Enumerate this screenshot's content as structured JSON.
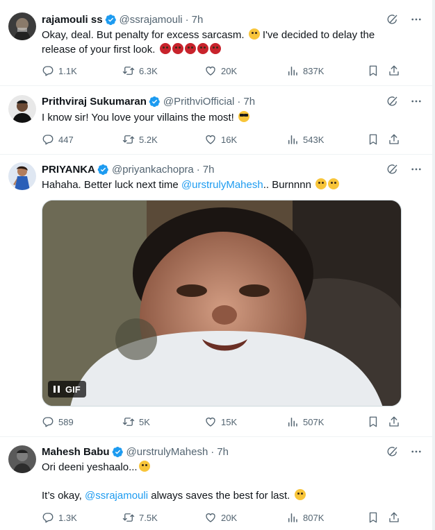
{
  "tweets": [
    {
      "name": "rajamouli ss",
      "handle": "@ssrajamouli",
      "sep": "·",
      "time": "7h",
      "text1": "Okay, deal. But penalty for excess sarcasm.",
      "text2": "I've decided  to delay the release of your first look.",
      "replies": "1.1K",
      "retweets": "6.3K",
      "likes": "20K",
      "views": "837K"
    },
    {
      "name": "Prithviraj Sukumaran",
      "handle": "@PrithviOfficial",
      "sep": "·",
      "time": "7h",
      "text1": "I know sir! You love your villains the most!",
      "replies": "447",
      "retweets": "5.2K",
      "likes": "16K",
      "views": "543K"
    },
    {
      "name": "PRIYANKA",
      "handle": "@priyankachopra",
      "sep": "·",
      "time": "7h",
      "text1": "Hahaha. Better luck next time ",
      "mention": "@urstrulyMahesh",
      "text2": ".. Burnnnn",
      "gif_label": "GIF",
      "replies": "589",
      "retweets": "5K",
      "likes": "15K",
      "views": "507K"
    },
    {
      "name": "Mahesh Babu",
      "handle": "@urstrulyMahesh",
      "sep": "·",
      "time": "7h",
      "text1": "Ori deeni yeshaalo...",
      "text2": "It’s okay, ",
      "mention": "@ssrajamouli",
      "text3": " always saves the best for last.",
      "replies": "1.3K",
      "retweets": "7.5K",
      "likes": "20K",
      "views": "807K"
    }
  ],
  "icons": [
    "verified-badge-icon",
    "grok-icon",
    "more-icon",
    "reply-icon",
    "retweet-icon",
    "like-icon",
    "views-icon",
    "bookmark-icon",
    "share-icon",
    "pause-icon"
  ],
  "colors": {
    "accent": "#1d9bf0",
    "muted": "#536471",
    "border": "#eff3f4",
    "text": "#0f1419"
  }
}
